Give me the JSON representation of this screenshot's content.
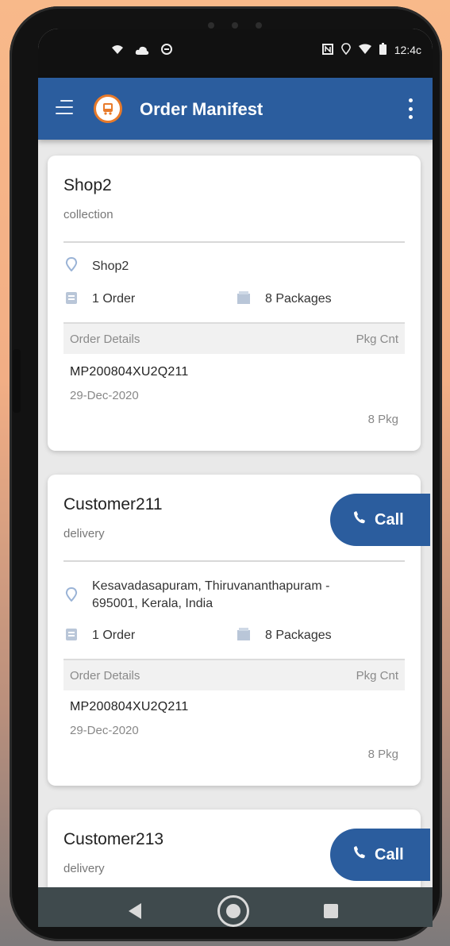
{
  "status_bar": {
    "time": "12:4ᴄ",
    "left_icons": [
      "wifi-icon",
      "cloud-icon",
      "sync-icon"
    ],
    "right_icons": [
      "nfc-icon",
      "location-icon",
      "signal-icon",
      "battery-icon"
    ]
  },
  "app_bar": {
    "title": "Order Manifest",
    "menu_icon": "hamburger-menu-icon",
    "logo_icon": "app-logo-icon",
    "overflow_icon": "kebab-menu-icon",
    "color": "#2b5d9e"
  },
  "cards": [
    {
      "name": "Shop2",
      "type": "collection",
      "address": "Shop2",
      "orders": "1 Order",
      "packages": "8 Packages",
      "details_header": "Order Details",
      "pkg_header": "Pkg Cnt",
      "order_id": "MP200804XU2Q211",
      "date": "29-Dec-2020",
      "pkg_count": "8 Pkg"
    },
    {
      "name": "Customer211",
      "type": "delivery",
      "call_label": "Call",
      "address_line1": "Kesavadasapuram, Thiruvananthapuram -",
      "address_line2": "695001, Kerala, India",
      "orders": "1 Order",
      "packages": "8 Packages",
      "details_header": "Order Details",
      "pkg_header": "Pkg Cnt",
      "order_id": "MP200804XU2Q211",
      "date": "29-Dec-2020",
      "pkg_count": "8 Pkg"
    },
    {
      "name": "Customer213",
      "type": "delivery",
      "call_label": "Call"
    }
  ],
  "nav_bar": {
    "icons": [
      "back-icon",
      "home-icon",
      "recents-icon"
    ]
  }
}
